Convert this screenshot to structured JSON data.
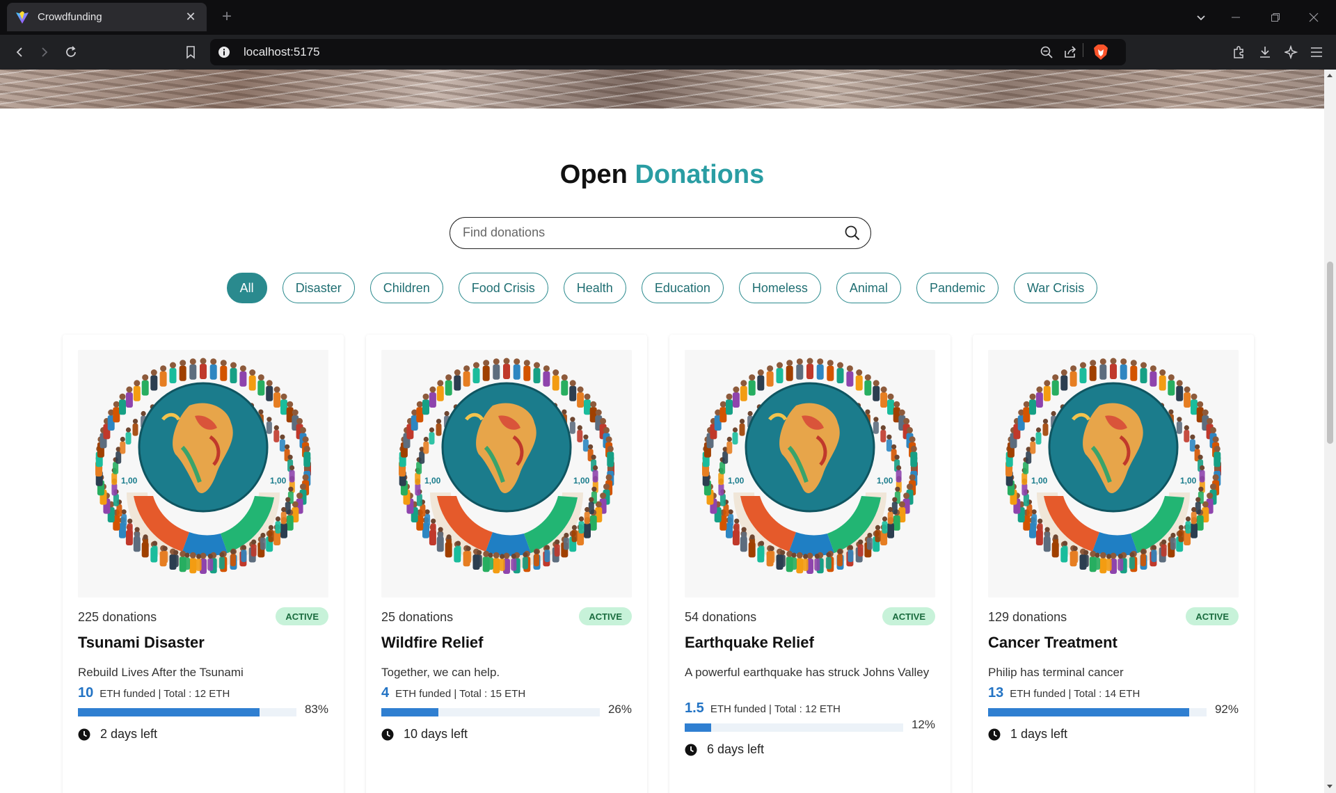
{
  "browser": {
    "tab_title": "Crowdfunding",
    "url": "localhost:5175"
  },
  "page": {
    "heading_bold": "Open",
    "heading_accent": "Donations",
    "search_placeholder": "Find donations",
    "filters": [
      "All",
      "Disaster",
      "Children",
      "Food Crisis",
      "Health",
      "Education",
      "Homeless",
      "Animal",
      "Pandemic",
      "War Crisis"
    ],
    "active_filter": "All"
  },
  "campaigns": [
    {
      "donations": "225 donations",
      "status": "ACTIVE",
      "title": "Tsunami Disaster",
      "description": "Rebuild Lives After the Tsunami",
      "funded": "10",
      "funded_text": "ETH funded | Total : 12 ETH",
      "percent": 83,
      "percent_label": "83%",
      "days_left": "2 days left"
    },
    {
      "donations": "25 donations",
      "status": "ACTIVE",
      "title": "Wildfire Relief",
      "description": "Together, we can help.",
      "funded": "4",
      "funded_text": "ETH funded | Total : 15 ETH",
      "percent": 26,
      "percent_label": "26%",
      "days_left": "10 days left"
    },
    {
      "donations": "54 donations",
      "status": "ACTIVE",
      "title": "Earthquake Relief",
      "description": "A powerful earthquake has struck Johns Valley",
      "funded": "1.5",
      "funded_text": "ETH funded | Total : 12 ETH",
      "percent": 12,
      "percent_label": "12%",
      "days_left": "6 days left"
    },
    {
      "donations": "129 donations",
      "status": "ACTIVE",
      "title": "Cancer Treatment",
      "description": "Philip has terminal cancer",
      "funded": "13",
      "funded_text": "ETH funded | Total : 14 ETH",
      "percent": 92,
      "percent_label": "92%",
      "days_left": "1 days left"
    }
  ],
  "colors": {
    "accent_teal": "#2a9da3",
    "chip_teal": "#2a8a8e",
    "progress_blue": "#2f7fd1",
    "badge_green": "#c7f2d9"
  },
  "icons": {
    "card_image": "globe-with-people-illustration",
    "clock": "clock-icon",
    "search": "search-icon"
  }
}
